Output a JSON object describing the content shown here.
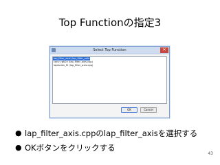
{
  "slide": {
    "title": "Top Functionの指定3",
    "page_number": "43"
  },
  "dialog": {
    "title": "Select Top Function",
    "close_label": "✕",
    "items": [
      {
        "label": "lap_filter_axis (lap_filter_axis.cpp)",
        "selected": true
      },
      {
        "label": "conv_rgb2y (lap_filter_axis.cpp)",
        "selected": false
      },
      {
        "label": "laplacian_fil (lap_filter_axis.cpp)",
        "selected": false
      }
    ],
    "ok_label": "OK",
    "cancel_label": "Cancel"
  },
  "bullets": [
    "lap_filter_axis.cppのlap_filter_axisを選択する",
    "OKボタンをクリックする"
  ],
  "bullet_symbol": "●",
  "colors": {
    "selection": "#2f6fd6",
    "titlebar": "#cfdcf0",
    "close": "#c7463d"
  }
}
